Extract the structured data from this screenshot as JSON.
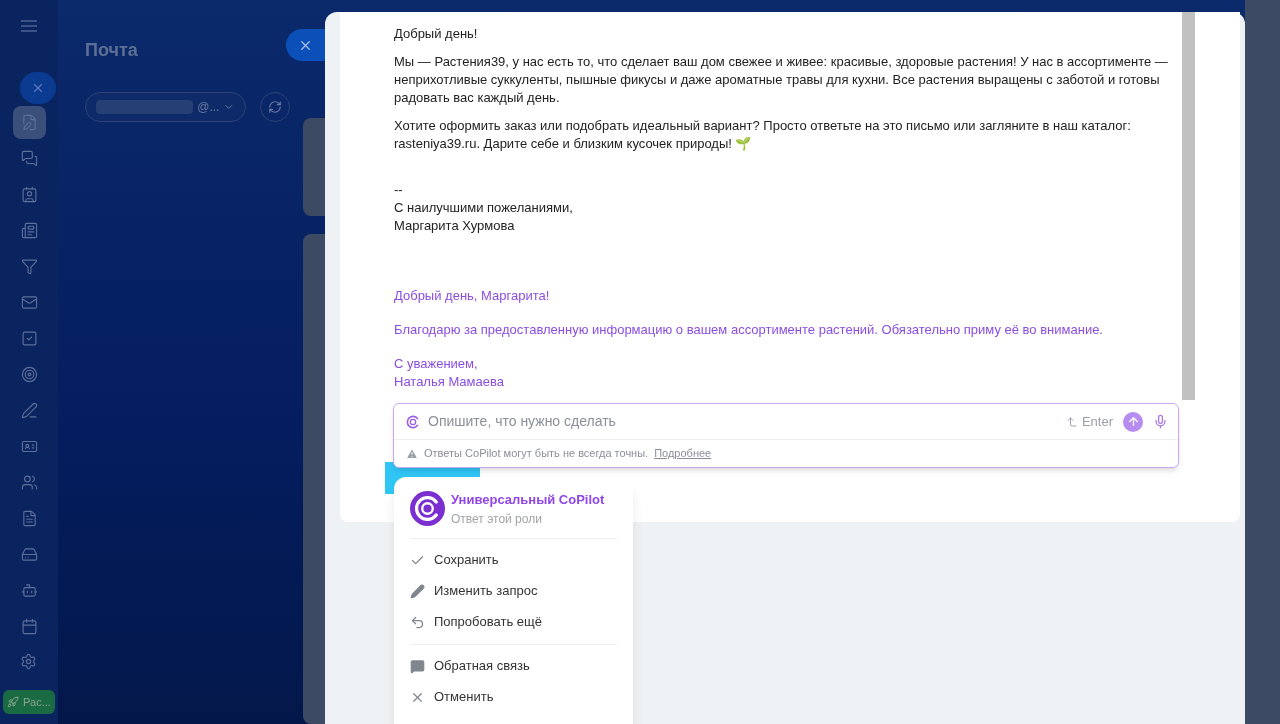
{
  "page": {
    "title": "Почта",
    "mailbox": {
      "value": "@..."
    }
  },
  "sidebar": {
    "items": [
      {
        "selected": true
      },
      {
        "selected": false
      },
      {
        "selected": false
      },
      {
        "selected": false
      },
      {
        "selected": false
      },
      {
        "selected": false
      },
      {
        "selected": false
      },
      {
        "selected": false
      },
      {
        "selected": false
      },
      {
        "selected": false
      },
      {
        "selected": false
      },
      {
        "selected": false
      },
      {
        "selected": false
      },
      {
        "selected": false
      },
      {
        "selected": false
      }
    ],
    "bottom_button": "Рас..."
  },
  "letter": {
    "greeting": "Добрый день!",
    "paragraphs": [
      "Мы — Растения39, у нас есть то, что сделает ваш дом свежее и живее: красивые, здоровые растения! У нас в ассортименте — неприхотливые суккуленты, пышные фикусы и даже ароматные травы для кухни. Все растения выращены с заботой и готовы радовать вас каждый день.",
      "Хотите оформить заказ или подобрать идеальный вариант? Просто ответьте на это письмо или загляните в наш каталог: rasteniya39.ru. Дарите себе и близким кусочек природы! 🌱"
    ],
    "signature": [
      "--",
      "С наилучшими пожеланиями,",
      "Маргарита Хурмова"
    ]
  },
  "reply": {
    "greeting": "Добрый день, Маргарита!",
    "body": "Благодарю за предоставленную информацию о вашем ассортименте растений. Обязательно приму её во внимание.",
    "signature": [
      "С уважением,",
      "Наталья Мамаева"
    ]
  },
  "copilot": {
    "placeholder": "Опишите, что нужно сделать",
    "enter_hint": "Enter",
    "warning": "Ответы CoPilot могут быть не всегда точны.",
    "warning_link": "Подробнее"
  },
  "menu": {
    "title": "Универсальный CoPilot",
    "subtitle": "Ответ этой роли",
    "groups": [
      [
        {
          "kind": "save",
          "label": "Сохранить"
        },
        {
          "kind": "edit",
          "label": "Изменить запрос"
        },
        {
          "kind": "retry",
          "label": "Попробовать ещё"
        }
      ],
      [
        {
          "kind": "feedback",
          "label": "Обратная связь"
        },
        {
          "kind": "cancel",
          "label": "Отменить"
        }
      ]
    ]
  }
}
